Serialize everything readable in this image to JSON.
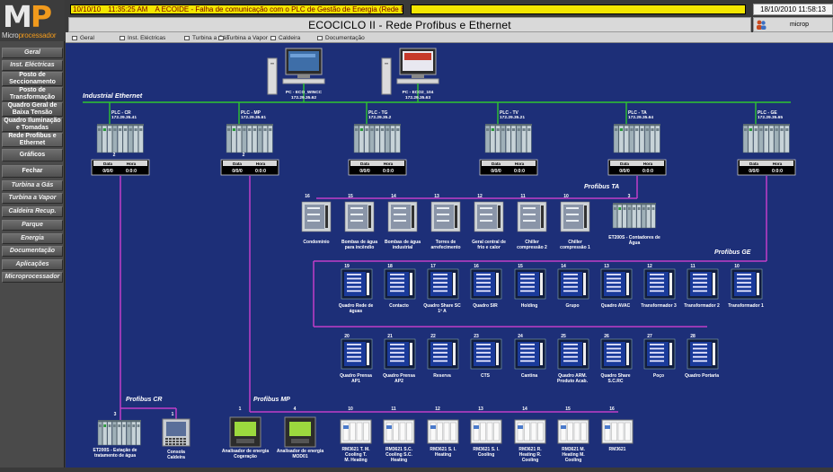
{
  "logo": {
    "brand_letters_a": "M",
    "brand_letters_b": "P",
    "sub_a": "Micro",
    "sub_b": "processador"
  },
  "sidebar": {
    "items": [
      {
        "label": "Geral",
        "italic": true
      },
      {
        "label": "Inst. Eléctricas",
        "italic": true
      },
      {
        "label": "Posto de Seccionamento"
      },
      {
        "label": "Posto de Transformação"
      },
      {
        "label": "Quadro Geral de Baixa Tensão"
      },
      {
        "label": "Quadro Iluminação e Tomadas"
      },
      {
        "label": "Rede Profibus e Ethernet"
      },
      {
        "label": "Gráficos"
      },
      {
        "label": "Fechar"
      },
      {
        "label": "Turbina a Gás",
        "italic": true
      },
      {
        "label": "Turbina a Vapor",
        "italic": true
      },
      {
        "label": "Caldeira Recup.",
        "italic": true
      },
      {
        "label": "Parque",
        "italic": true
      },
      {
        "label": "Energia",
        "italic": true
      },
      {
        "label": "Documentação",
        "italic": true
      },
      {
        "label": "Aplicações",
        "italic": true
      },
      {
        "label": "Microprocessador",
        "italic": true
      }
    ]
  },
  "alarm": {
    "date": "10/10/10",
    "time": "11:35:25 AM",
    "message": "A ECOIDE - Falha de comunicação com o PLC de Gestão de Energia (Rede Ethern"
  },
  "clock": "18/10/2010 11:58:13",
  "title": "ECOCICLO II - Rede Profibus e Ethernet",
  "user": "microp",
  "tabs": [
    "Geral",
    "Inst. Eléctricas",
    "Turbina a Gás",
    "Turbina a Vapor",
    "Caldeira",
    "Documentação"
  ],
  "network": {
    "ethernet_label": "Industrial Ethernet",
    "pcs": [
      {
        "name": "PC - ECO_WINCC",
        "ip": "172.29.35.62"
      },
      {
        "name": "PC - ECO2_104",
        "ip": "172.29.35.63"
      }
    ],
    "plcs": [
      {
        "name": "PLC - CR",
        "ip": "172.29.35.41",
        "num": "2"
      },
      {
        "name": "PLC - MP",
        "ip": "172.29.35.61",
        "num": "2"
      },
      {
        "name": "PLC - TG",
        "ip": "172.29.35.2",
        "num": ""
      },
      {
        "name": "PLC - TV",
        "ip": "172.29.35.21",
        "num": ""
      },
      {
        "name": "PLC - TA",
        "ip": "172.29.35.64",
        "num": ""
      },
      {
        "name": "PLC - GE",
        "ip": "172.29.35.65",
        "num": ""
      }
    ],
    "datetime_header": {
      "date": "Data",
      "time": "Hora"
    },
    "datetime_value": {
      "date": "0/0/0",
      "time": "0:0:0"
    },
    "profibus_ta": {
      "label": "Profibus TA",
      "devices": [
        {
          "num": "16",
          "label": "Condomínio"
        },
        {
          "num": "15",
          "label": "Bombas de água para incêndio"
        },
        {
          "num": "14",
          "label": "Bombas de água industrial"
        },
        {
          "num": "13",
          "label": "Torres de arrefecimento"
        },
        {
          "num": "12",
          "label": "Geral central de frio e calor"
        },
        {
          "num": "11",
          "label": "Chiller compressão 2"
        },
        {
          "num": "10",
          "label": "Chiller compressão 1"
        },
        {
          "num": "3",
          "label": "ET200S - Contadores de Água"
        }
      ]
    },
    "profibus_ge": {
      "label": "Profibus GE",
      "row1": [
        {
          "num": "19",
          "label": "Quadro Rede de águas"
        },
        {
          "num": "18",
          "label": "Contacto"
        },
        {
          "num": "17",
          "label": "Quadro Share SC 1º A"
        },
        {
          "num": "16",
          "label": "Quadro SIR"
        },
        {
          "num": "15",
          "label": "Holding"
        },
        {
          "num": "14",
          "label": "Grupo"
        },
        {
          "num": "13",
          "label": "Quadro AVAC"
        },
        {
          "num": "12",
          "label": "Transformador 3"
        },
        {
          "num": "11",
          "label": "Transformador 2"
        },
        {
          "num": "10",
          "label": "Transformador 1"
        }
      ],
      "row2": [
        {
          "num": "20",
          "label": "Quadro Prensa AP1"
        },
        {
          "num": "21",
          "label": "Quadro Prensa AP2"
        },
        {
          "num": "22",
          "label": "Reserva"
        },
        {
          "num": "23",
          "label": "CTS"
        },
        {
          "num": "24",
          "label": "Cantina"
        },
        {
          "num": "25",
          "label": "Quadro ARM. Produto Acab."
        },
        {
          "num": "26",
          "label": "Quadro Share S.C.RC"
        },
        {
          "num": "27",
          "label": "Poço"
        },
        {
          "num": "28",
          "label": "Quadro Portaria"
        }
      ]
    },
    "profibus_cr": {
      "label": "Profibus CR",
      "devices": [
        {
          "num": "3",
          "label": "ET200S - Estação de tratamento de água"
        },
        {
          "num": "1",
          "label": "Consola Caldeira"
        }
      ]
    },
    "profibus_mp": {
      "label": "Profibus MP",
      "devices": [
        {
          "num": "1",
          "label": "Analisador de energia Cogeração"
        },
        {
          "num": "4",
          "label": "Analisador de energia MOD01"
        },
        {
          "num": "10",
          "label": "RM3621 T. M. Cooling T. M. Heating"
        },
        {
          "num": "11",
          "label": "RM3621 S.C. Cooling S.C. Heating"
        },
        {
          "num": "12",
          "label": "RM3621 S. I. Heating"
        },
        {
          "num": "13",
          "label": "RM3621 S. I. Cooling"
        },
        {
          "num": "14",
          "label": "RM3621 R. Heating R. Cooling"
        },
        {
          "num": "15",
          "label": "RM3621 M. Heating M. Cooling"
        },
        {
          "num": "16",
          "label": "RM3621"
        }
      ]
    }
  },
  "colors": {
    "background": "#1d2f78",
    "ethernet": "#2fc52f",
    "profibus": "#c23fc8",
    "alarm": "#f3e600"
  }
}
